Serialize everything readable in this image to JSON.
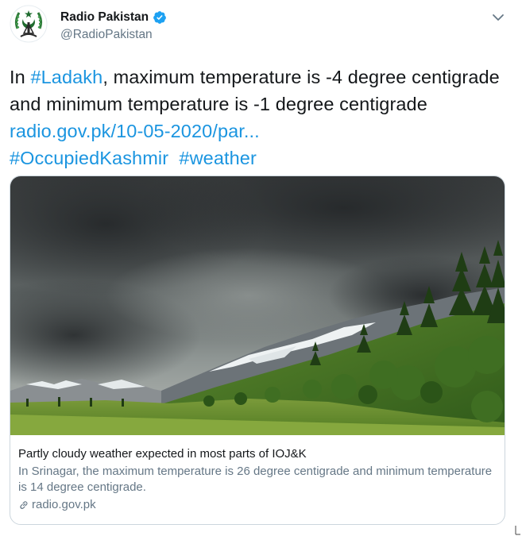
{
  "author": {
    "name": "Radio Pakistan",
    "handle": "@RadioPakistan",
    "verified_color": "#1da1f2"
  },
  "tweet": {
    "text_1": "In ",
    "hashtag_ladakh": "#Ladakh",
    "text_2": ", maximum temperature is -4 degree centigrade and minimum temperature is -1 degree centigrade  ",
    "link": "radio.gov.pk/10-05-2020/par...",
    "hashtag_kashmir": "#OccupiedKashmir",
    "spacer": "  ",
    "hashtag_weather": "#weather"
  },
  "card": {
    "title": "Partly cloudy weather expected in most parts of IOJ&K",
    "description": "In Srinagar, the maximum temperature is 26 degree centigrade and minimum temperature is 14 degree centigrade.",
    "domain": "radio.gov.pk"
  },
  "icons": {
    "caret": "chevron-down-icon",
    "verified": "verified-badge-icon",
    "link": "link-icon"
  },
  "colors": {
    "link": "#1b95e0",
    "secondary_text": "#657786",
    "border": "#ccd6dd"
  }
}
